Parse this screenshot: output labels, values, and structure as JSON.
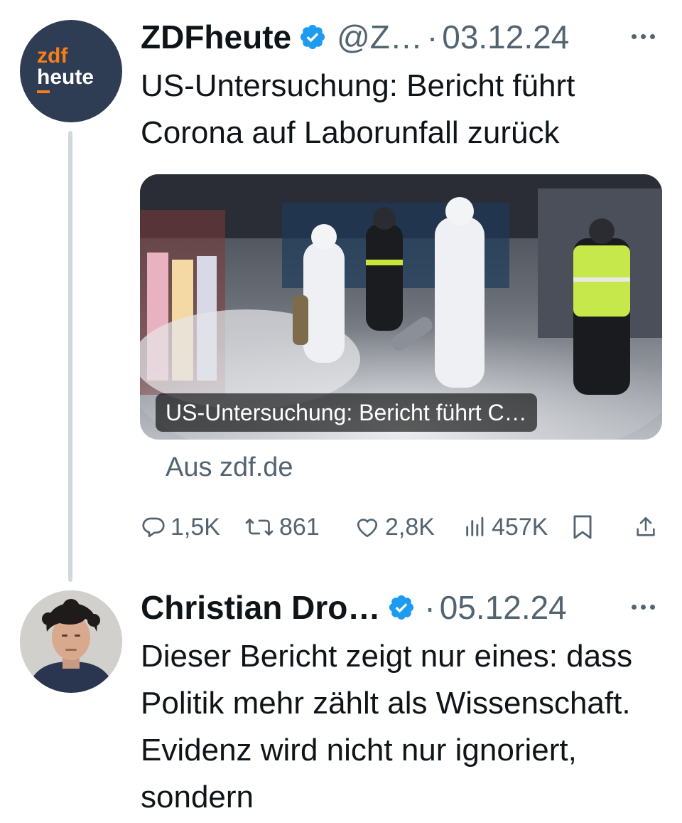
{
  "tweets": [
    {
      "avatar": {
        "line1": "zdf",
        "line2": "heute"
      },
      "name": "ZDFheute",
      "handle": "@Z…",
      "separator": "·",
      "date": "03.12.24",
      "text": "US-Untersuchung: Bericht führt Corona auf Laborunfall zurück",
      "card": {
        "caption": "US-Untersuchung: Bericht führt C…",
        "source": "Aus zdf.de"
      },
      "actions": {
        "replies": "1,5K",
        "reposts": "861",
        "likes": "2,8K",
        "views": "457K"
      },
      "icons": [
        "verified-badge-icon",
        "more-icon",
        "reply-icon",
        "repost-icon",
        "like-icon",
        "views-icon",
        "bookmark-icon",
        "share-icon"
      ]
    },
    {
      "name": "Christian Dro…",
      "separator": "·",
      "date": "05.12.24",
      "text": "Dieser Bericht zeigt nur eines: dass Politik mehr zählt als Wissenschaft. Evidenz wird nicht nur ignoriert, sondern",
      "icons": [
        "verified-badge-icon",
        "more-icon"
      ]
    }
  ],
  "colors": {
    "text_primary": "#0f1419",
    "text_secondary": "#536471",
    "verified_blue": "#1d9bf0",
    "thread_line": "#cfd9de",
    "zdf_avatar_bg": "#2e3d54",
    "zdf_orange": "#fa7d19"
  }
}
